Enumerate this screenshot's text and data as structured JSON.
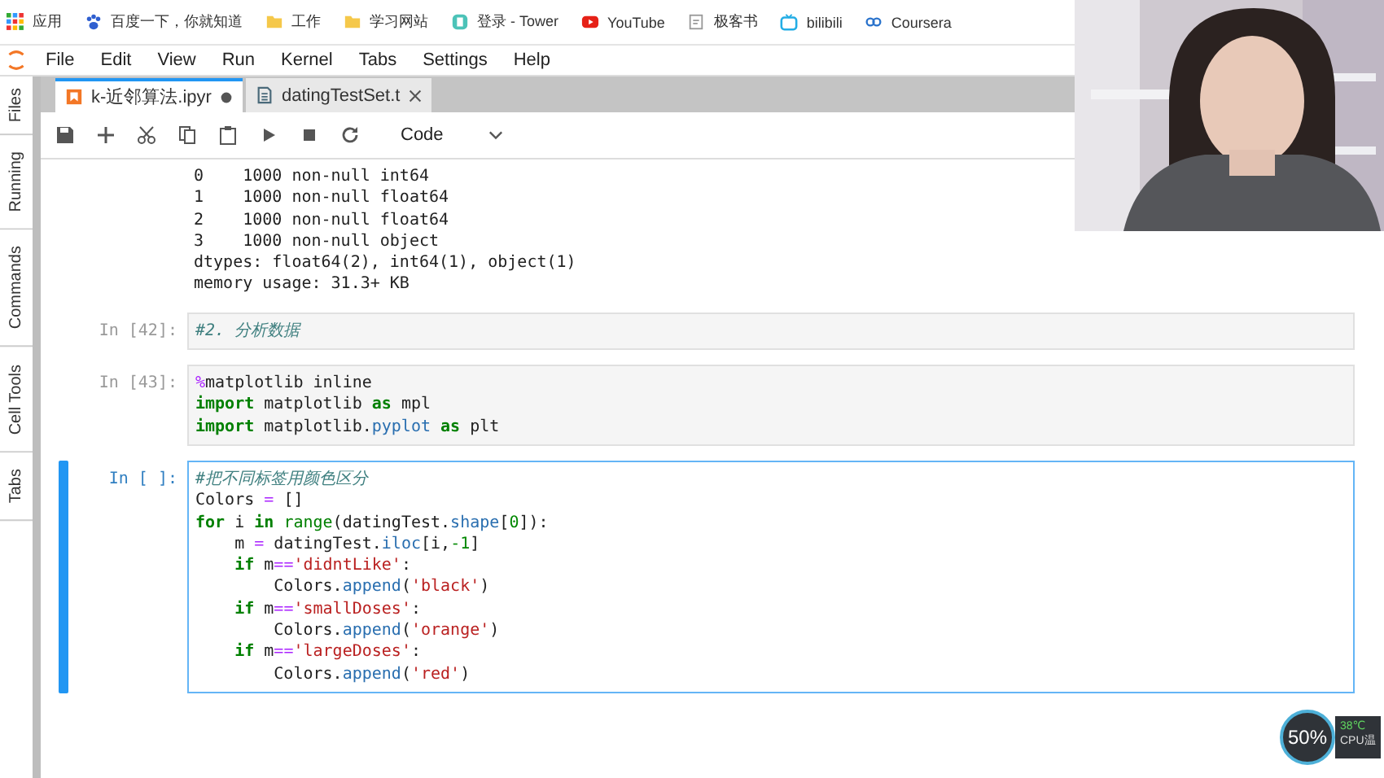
{
  "bookmarks": [
    {
      "label": "应用",
      "kind": "apps"
    },
    {
      "label": "百度一下，你就知道",
      "kind": "paw"
    },
    {
      "label": "工作",
      "kind": "folder"
    },
    {
      "label": "学习网站",
      "kind": "folder"
    },
    {
      "label": "登录 - Tower",
      "kind": "tower"
    },
    {
      "label": "YouTube",
      "kind": "play"
    },
    {
      "label": "极客书",
      "kind": "page"
    },
    {
      "label": "bilibili",
      "kind": "tv"
    },
    {
      "label": "Coursera",
      "kind": "link"
    }
  ],
  "menu": [
    "File",
    "Edit",
    "View",
    "Run",
    "Kernel",
    "Tabs",
    "Settings",
    "Help"
  ],
  "side_tabs": [
    "Files",
    "Running",
    "Commands",
    "Cell Tools",
    "Tabs"
  ],
  "tabs": [
    {
      "label": "k-近邻算法.ipyr",
      "kind": "notebook",
      "selected": true,
      "modified": true
    },
    {
      "label": "datingTestSet.t",
      "kind": "text",
      "selected": false,
      "modified": false
    }
  ],
  "toolbar": {
    "cell_type": "Code"
  },
  "output": [
    "0    1000 non-null int64",
    "1    1000 non-null float64",
    "2    1000 non-null float64",
    "3    1000 non-null object",
    "dtypes: float64(2), int64(1), object(1)",
    "memory usage: 31.3+ KB"
  ],
  "cells": [
    {
      "prompt": "In [42]:",
      "selected": false,
      "lines": [
        [
          {
            "t": "#2. 分析数据",
            "kind": "cm"
          }
        ]
      ]
    },
    {
      "prompt": "In [43]:",
      "selected": false,
      "lines": [
        [
          {
            "t": "%",
            "kind": "op"
          },
          {
            "t": "matplotlib inline"
          }
        ],
        [
          {
            "t": "import",
            "kind": "kw"
          },
          {
            "t": " matplotlib "
          },
          {
            "t": "as",
            "kind": "kw"
          },
          {
            "t": " mpl"
          }
        ],
        [
          {
            "t": "import",
            "kind": "kw"
          },
          {
            "t": " matplotlib."
          },
          {
            "t": "pyplot",
            "kind": "attr"
          },
          {
            "t": " as",
            "kind": "kw"
          },
          {
            "t": " plt"
          }
        ]
      ]
    },
    {
      "prompt": "In [ ]:",
      "selected": true,
      "lines": [
        [
          {
            "t": "#把不同标签用颜色区分",
            "kind": "cm"
          }
        ],
        [
          {
            "t": "Colors "
          },
          {
            "t": "=",
            "kind": "op"
          },
          {
            "t": " []"
          }
        ],
        [
          {
            "t": "for",
            "kind": "kw"
          },
          {
            "t": " i "
          },
          {
            "t": "in",
            "kind": "kw"
          },
          {
            "t": " range",
            "kind": "bi"
          },
          {
            "t": "(datingTest."
          },
          {
            "t": "shape",
            "kind": "attr"
          },
          {
            "t": "["
          },
          {
            "t": "0",
            "kind": "num"
          },
          {
            "t": "]):"
          }
        ],
        [
          {
            "t": "    m "
          },
          {
            "t": "=",
            "kind": "op"
          },
          {
            "t": " datingTest."
          },
          {
            "t": "iloc",
            "kind": "attr"
          },
          {
            "t": "[i,"
          },
          {
            "t": "-1",
            "kind": "num"
          },
          {
            "t": "]"
          }
        ],
        [
          {
            "t": "    if",
            "kind": "kw"
          },
          {
            "t": " m"
          },
          {
            "t": "==",
            "kind": "op"
          },
          {
            "t": "'didntLike'",
            "kind": "str"
          },
          {
            "t": ":"
          }
        ],
        [
          {
            "t": "        Colors."
          },
          {
            "t": "append",
            "kind": "attr"
          },
          {
            "t": "("
          },
          {
            "t": "'black'",
            "kind": "str"
          },
          {
            "t": ")"
          }
        ],
        [
          {
            "t": "    if",
            "kind": "kw"
          },
          {
            "t": " m"
          },
          {
            "t": "==",
            "kind": "op"
          },
          {
            "t": "'smallDoses'",
            "kind": "str"
          },
          {
            "t": ":"
          }
        ],
        [
          {
            "t": "        Colors."
          },
          {
            "t": "append",
            "kind": "attr"
          },
          {
            "t": "("
          },
          {
            "t": "'orange'",
            "kind": "str"
          },
          {
            "t": ")"
          }
        ],
        [
          {
            "t": "    if",
            "kind": "kw"
          },
          {
            "t": " m"
          },
          {
            "t": "==",
            "kind": "op"
          },
          {
            "t": "'largeDoses'",
            "kind": "str"
          },
          {
            "t": ":"
          }
        ],
        [
          {
            "t": "        Colors."
          },
          {
            "t": "append",
            "kind": "attr"
          },
          {
            "t": "("
          },
          {
            "t": "'red'",
            "kind": "str"
          },
          {
            "t": ")"
          }
        ]
      ]
    }
  ],
  "webcam": {
    "kind": "picture"
  },
  "monitor": {
    "percent": "50%",
    "temperature": "38℃",
    "label": "CPU温"
  }
}
